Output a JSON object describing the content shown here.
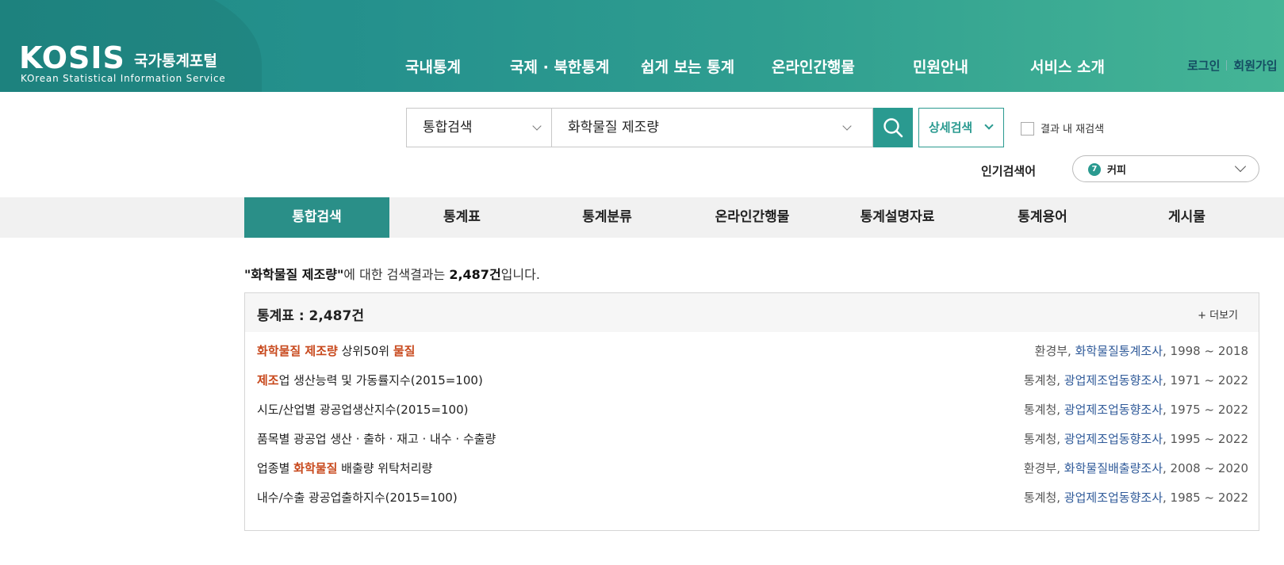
{
  "header": {
    "logo_text": "KOSIS",
    "logo_kr": "국가통계포털",
    "logo_en": "KOrean Statistical Information Service",
    "nav": [
      "국내통계",
      "국제 · 북한통계",
      "쉽게 보는 통계",
      "온라인간행물",
      "민원안내",
      "서비스 소개"
    ],
    "login": "로그인",
    "signup": "회원가입"
  },
  "search": {
    "scope": "통합검색",
    "query": "화학물질 제조량",
    "advanced_label": "상세검색",
    "research_label": "결과 내 재검색",
    "popular_label": "인기검색어",
    "popular_rank": "7",
    "popular_word": "커피"
  },
  "tabs": [
    "통합검색",
    "통계표",
    "통계분류",
    "온라인간행물",
    "통계설명자료",
    "통계용어",
    "게시물"
  ],
  "summary": {
    "query_quoted": "\"화학물질 제조량\"",
    "mid": "에 대한 검색결과는 ",
    "count": "2,487건",
    "tail": "입니다."
  },
  "panel": {
    "title": "통계표 : 2,487건",
    "more": "+ 더보기",
    "rows": [
      {
        "title_parts": [
          {
            "t": "화학물질 제조량",
            "hl": true
          },
          {
            "t": " 상위50위 ",
            "hl": false
          },
          {
            "t": "물질",
            "hl": true
          }
        ],
        "org": "환경부, ",
        "survey": "화학물질통계조사",
        "period": ", 1998 ~ 2018"
      },
      {
        "title_parts": [
          {
            "t": "제조",
            "hl": true
          },
          {
            "t": "업 생산능력 및 가동률지수(2015=100)",
            "hl": false
          }
        ],
        "org": "통계청, ",
        "survey": "광업제조업동향조사",
        "period": ", 1971 ~ 2022"
      },
      {
        "title_parts": [
          {
            "t": "시도/산업별 광공업생산지수(2015=100)",
            "hl": false
          }
        ],
        "org": "통계청, ",
        "survey": "광업제조업동향조사",
        "period": ", 1975 ~ 2022"
      },
      {
        "title_parts": [
          {
            "t": "품목별 광공업 생산 · 출하 · 재고 · 내수 · 수출량",
            "hl": false
          }
        ],
        "org": "통계청, ",
        "survey": "광업제조업동향조사",
        "period": ", 1995 ~ 2022"
      },
      {
        "title_parts": [
          {
            "t": "업종별 ",
            "hl": false
          },
          {
            "t": "화학물질",
            "hl": true
          },
          {
            "t": " 배출량 위탁처리량",
            "hl": false
          }
        ],
        "org": "환경부, ",
        "survey": "화학물질배출량조사",
        "period": ", 2008 ~ 2020"
      },
      {
        "title_parts": [
          {
            "t": "내수/수출 광공업출하지수(2015=100)",
            "hl": false
          }
        ],
        "org": "통계청, ",
        "survey": "광업제조업동향조사",
        "period": ", 1985 ~ 2022"
      }
    ]
  },
  "colors": {
    "brand": "#2a9a90",
    "highlight": "#c8491d",
    "link": "#2f5a99"
  }
}
